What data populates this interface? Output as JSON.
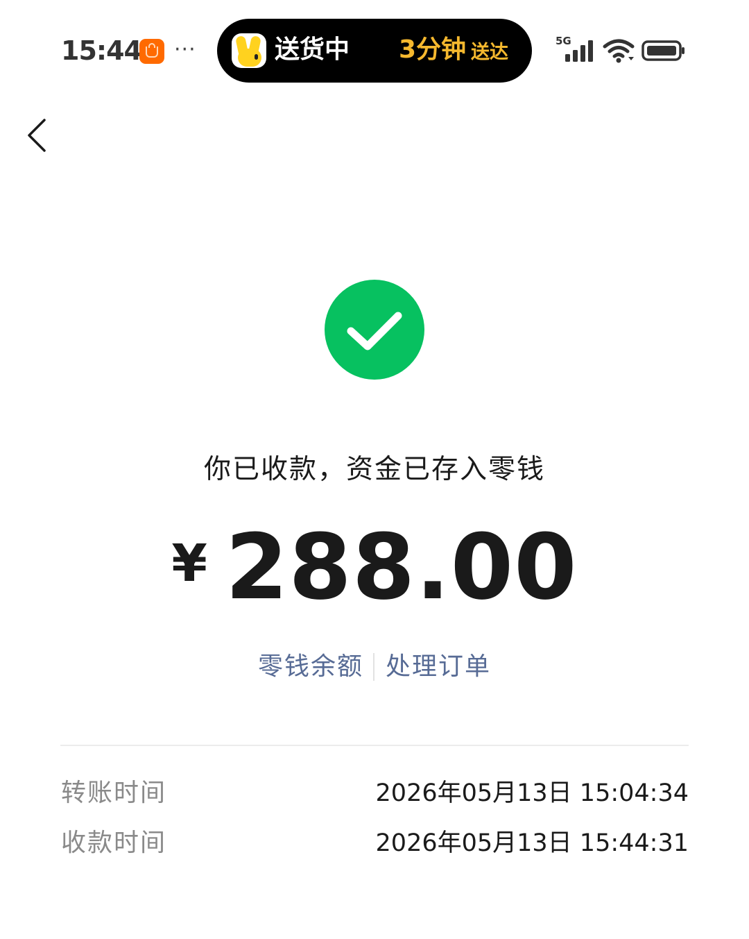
{
  "status_bar": {
    "time": "15:44",
    "more": "···",
    "network": "5G",
    "app_icon": "shopping-bag-icon"
  },
  "live_activity": {
    "status": "送货中",
    "eta_number": "3分钟",
    "eta_suffix": "送达",
    "accent_color": "#f5b82e"
  },
  "nav": {
    "back_icon": "chevron-left-icon"
  },
  "result": {
    "icon": "check-circle-icon",
    "icon_color": "#07c160",
    "message": "你已收款，资金已存入零钱",
    "currency": "¥",
    "amount": "288.00"
  },
  "links": {
    "balance": "零钱余额",
    "order": "处理订单",
    "color": "#576b95"
  },
  "details": [
    {
      "label": "转账时间",
      "value": "2026年05月13日 15:04:34"
    },
    {
      "label": "收款时间",
      "value": "2026年05月13日 15:44:31"
    }
  ]
}
